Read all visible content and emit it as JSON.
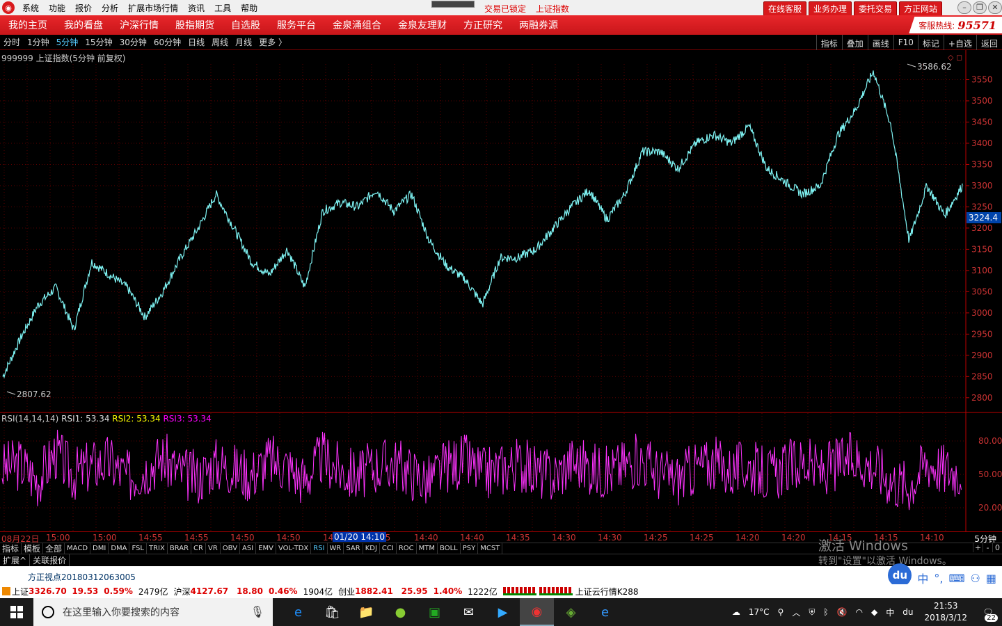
{
  "menubar": {
    "items": [
      "系统",
      "功能",
      "报价",
      "分析",
      "扩展市场行情",
      "资讯",
      "工具",
      "帮助"
    ],
    "status": [
      "交易已锁定",
      "上证指数"
    ],
    "buttons": [
      "在线客服",
      "业务办理",
      "委托交易",
      "方正网站"
    ]
  },
  "navbar": {
    "items": [
      "我的主页",
      "我的看盘",
      "沪深行情",
      "股指期货",
      "自选股",
      "服务平台",
      "金泉涌组合",
      "金泉友理财",
      "方正研究",
      "两融券源"
    ],
    "hotline_label": "客服热线:",
    "hotline_number": "95571"
  },
  "periodbar": {
    "items": [
      "分时",
      "1分钟",
      "5分钟",
      "15分钟",
      "30分钟",
      "60分钟",
      "日线",
      "周线",
      "月线",
      "更多 〉"
    ],
    "active": "5分钟",
    "tools": [
      "指标",
      "叠加",
      "画线",
      "F10",
      "标记",
      "+自选",
      "返回"
    ]
  },
  "chart": {
    "title": "999999 上证指数(5分钟 前复权)",
    "high_label": "3586.62",
    "low_label": "2807.62",
    "last_label": "3224.4",
    "yticks": [
      "3550",
      "3500",
      "3450",
      "3400",
      "3350",
      "3300",
      "3250",
      "3200",
      "3150",
      "3100",
      "3050",
      "3000",
      "2950",
      "2900",
      "2850",
      "2800"
    ]
  },
  "rsi": {
    "name": "RSI(14,14,14)",
    "rsi1": "RSI1: 53.34",
    "rsi2": "RSI2: 53.34",
    "rsi3": "RSI3: 53.34",
    "yticks": [
      "80.00",
      "50.00",
      "20.00"
    ]
  },
  "timeaxis": {
    "labels": [
      "08月22日",
      "15:00",
      "15:00",
      "14:55",
      "14:55",
      "14:50",
      "14:50",
      "14",
      "45",
      "14:40",
      "14:40",
      "14:35",
      "14:30",
      "14:30",
      "14:25",
      "14:25",
      "14:20",
      "14:20",
      "14:15",
      "14:15",
      "14:10"
    ],
    "highlight": "01/20 14:10",
    "period": "5分钟"
  },
  "indtabs": {
    "items": [
      "指标",
      "模板",
      "全部",
      "MACD",
      "DMI",
      "DMA",
      "FSL",
      "TRIX",
      "BRAR",
      "CR",
      "VR",
      "OBV",
      "ASI",
      "EMV",
      "VOL-TDX",
      "RSI",
      "WR",
      "SAR",
      "KDJ",
      "CCI",
      "ROC",
      "MTM",
      "BOLL",
      "PSY",
      "MCST"
    ],
    "active": "RSI",
    "controls": [
      "+",
      "-",
      "0"
    ]
  },
  "extbar": {
    "items": [
      "扩展^",
      "关联报价"
    ]
  },
  "watermark": {
    "line1": "激活 Windows",
    "line2": "转到\"设置\"以激活 Windows。"
  },
  "news": {
    "text": "方正视点20180312063005"
  },
  "ticker": {
    "sh_label": "上证",
    "sh_value": "3326.70",
    "sh_change": "19.53",
    "sh_pct": "0.59%",
    "sh_amt": "2479亿",
    "hs_label": "沪深",
    "hs_value": "4127.67",
    "hs_change": "18.80",
    "hs_pct": "0.46%",
    "hs_amt": "1904亿",
    "cy_label": "创业",
    "cy_value": "1882.41",
    "cy_change": "25.95",
    "cy_pct": "1.40%",
    "cy_amt": "1222亿",
    "cloud": "上证云行情K288"
  },
  "taskbar": {
    "search_placeholder": "在这里输入你要搜索的内容",
    "weather": "17°C",
    "ime_lang": "中",
    "time": "21:53",
    "date": "2018/3/12",
    "notif_count": "22"
  },
  "chart_data": {
    "type": "line",
    "series": [
      {
        "name": "上证指数",
        "values": [
          2850,
          2940,
          3020,
          3060,
          2960,
          3120,
          3090,
          3060,
          2990,
          3050,
          3130,
          3200,
          3280,
          3200,
          3120,
          3090,
          3150,
          3060,
          3240,
          3260,
          3250,
          3290,
          3240,
          3280,
          3170,
          3110,
          3080,
          3020,
          3130,
          3130,
          3150,
          3200,
          3250,
          3290,
          3220,
          3280,
          3380,
          3380,
          3340,
          3400,
          3420,
          3400,
          3440,
          3340,
          3310,
          3280,
          3300,
          3420,
          3480,
          3570,
          3440,
          3170,
          3300,
          3230,
          3300
        ]
      },
      {
        "name": "RSI1",
        "values": [
          55,
          60,
          45,
          70,
          50,
          58,
          62,
          48,
          55,
          65,
          52,
          47,
          60,
          55,
          50,
          63,
          58,
          45,
          66,
          54,
          49,
          57,
          61,
          52,
          44,
          58,
          63,
          50,
          55,
          60,
          53,
          48,
          62,
          57,
          51,
          59,
          64,
          50,
          46,
          56,
          60,
          53,
          58,
          49,
          55,
          61,
          52,
          60,
          64,
          58,
          45,
          40,
          62,
          55,
          53
        ]
      }
    ],
    "ylim": [
      2780,
      3600
    ],
    "rsi_ylim": [
      0,
      100
    ],
    "high": 3586.62,
    "low": 2807.62,
    "last": 3224.4
  }
}
